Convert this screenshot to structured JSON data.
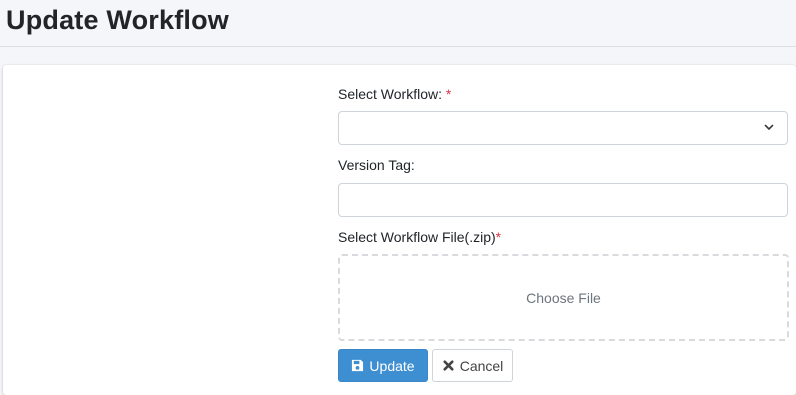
{
  "header": {
    "title": "Update Workflow"
  },
  "form": {
    "workflow_label": "Select Workflow:",
    "workflow_required": "*",
    "workflow_value": "",
    "version_label": "Version Tag:",
    "version_value": "",
    "file_label": "Select Workflow File(.zip)",
    "file_required": "*",
    "dropzone_text": "Choose File"
  },
  "buttons": {
    "update_label": "Update",
    "update_icon": "save-icon",
    "cancel_label": "Cancel",
    "cancel_icon": "times-icon"
  },
  "colors": {
    "primary": "#3d8fd2",
    "required": "#dc3545",
    "background": "#f4f6f9"
  }
}
